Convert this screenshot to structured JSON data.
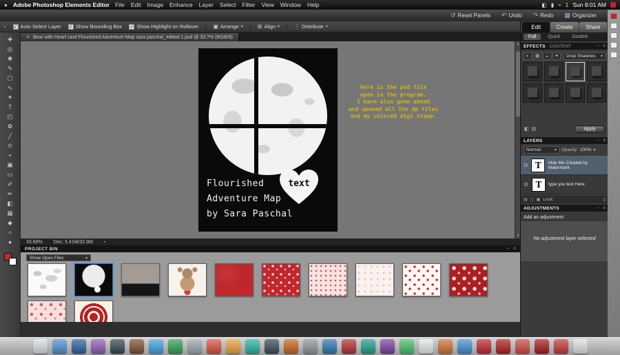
{
  "icons": {
    "apple": "●",
    "display": "◧",
    "battery": "▮",
    "wifi": "≈",
    "reset_panels": "↺",
    "undo": "↶",
    "redo": "↷",
    "organizer": "▦",
    "arrange": "▣",
    "align": "⊞",
    "distribute": "⋮",
    "dropdown_arrow": "▾",
    "close": "✕",
    "check": "✓",
    "collapse": "−",
    "panel_menu": "≡",
    "eye": "⊙",
    "text_layer_thumb": "T",
    "scroll_up": "▲",
    "scroll_down": "▼",
    "status_arrow": "▸",
    "trash": "▯"
  },
  "menubar": {
    "app_name": "Adobe Photoshop Elements Editor",
    "menus": [
      "File",
      "Edit",
      "Image",
      "Enhance",
      "Layer",
      "Select",
      "Filter",
      "View",
      "Window",
      "Help"
    ],
    "notification_count": "1",
    "clock": "Sun 8:01 AM"
  },
  "toolbar": {
    "reset_panels": "Reset Panels",
    "undo": "Undo",
    "redo": "Redo",
    "organizer": "Organizer"
  },
  "options_bar": {
    "checkboxes": [
      "Auto Select Layer",
      "Show Bounding Box",
      "Show Highlight on Rollover"
    ],
    "arrange": "Arrange",
    "align": "Align",
    "distribute": "Distribute"
  },
  "document": {
    "tab_title": "Bear with Heart card Flourished Adventure Map sara paschal_edited-1.psd @ 33.7% (RGB/8)",
    "card": {
      "title_lines": [
        "Flourished",
        "Adventure Map",
        "by Sara Paschal"
      ],
      "heart_text": "text"
    },
    "annotation_lines": [
      "here is the psd file",
      "open in the program.",
      "I have also gone ahead",
      "and opened all the dp files",
      "and my colored digi stamp."
    ],
    "annotation_color": "#d6b411"
  },
  "status_bar": {
    "zoom": "33.69%",
    "doc_size": "Doc: 5.41M/32.8M"
  },
  "tools": [
    {
      "name": "move-tool",
      "glyph": "✚"
    },
    {
      "name": "zoom-tool",
      "glyph": "◎"
    },
    {
      "name": "hand-tool",
      "glyph": "✱"
    },
    {
      "name": "eyedropper-tool",
      "glyph": "✎"
    },
    {
      "name": "rectangular-marquee-tool",
      "glyph": "▢"
    },
    {
      "name": "lasso-tool",
      "glyph": "∿"
    },
    {
      "name": "magic-wand-tool",
      "glyph": "✦"
    },
    {
      "name": "type-tool",
      "glyph": "T"
    },
    {
      "name": "crop-tool",
      "glyph": "◰"
    },
    {
      "name": "cookie-cutter-tool",
      "glyph": "✿"
    },
    {
      "name": "straighten-tool",
      "glyph": "╱"
    },
    {
      "name": "red-eye-removal-tool",
      "glyph": "⊙"
    },
    {
      "name": "healing-brush-tool",
      "glyph": "⌖"
    },
    {
      "name": "clone-stamp-tool",
      "glyph": "▣"
    },
    {
      "name": "eraser-tool",
      "glyph": "▭"
    },
    {
      "name": "brush-tool",
      "glyph": "✐"
    },
    {
      "name": "smart-brush-tool",
      "glyph": "✏"
    },
    {
      "name": "paint-bucket-tool",
      "glyph": "◧"
    },
    {
      "name": "gradient-tool",
      "glyph": "▦"
    },
    {
      "name": "shape-tool",
      "glyph": "◆"
    },
    {
      "name": "blur-tool",
      "glyph": "≈"
    },
    {
      "name": "sponge-tool",
      "glyph": "●"
    }
  ],
  "swatches": {
    "foreground": "#c1272d",
    "background": "#ffffff"
  },
  "project_bin": {
    "title": "PROJECT BIN",
    "dropdown": "Show Open Files",
    "row1": [
      {
        "kind": "world-map"
      },
      {
        "kind": "black-card",
        "selected": true
      },
      {
        "kind": "gray-card"
      },
      {
        "kind": "bear-stamp"
      },
      {
        "kind": "red-solid"
      },
      {
        "kind": "red-floral"
      },
      {
        "kind": "pink-dots"
      },
      {
        "kind": "light-pink-floral"
      },
      {
        "kind": "red-hearts"
      },
      {
        "kind": "red-damask"
      }
    ],
    "row2": [
      {
        "kind": "pink-floral"
      },
      {
        "kind": "red-medallion"
      }
    ]
  },
  "panels": {
    "tabs": [
      {
        "label": "Edit",
        "active": true
      },
      {
        "label": "Create",
        "active": false
      },
      {
        "label": "Share",
        "active": false
      }
    ],
    "subtabs": [
      {
        "label": "Full",
        "active": true
      },
      {
        "label": "Quick",
        "active": false
      },
      {
        "label": "Guided",
        "active": false
      }
    ],
    "effects": {
      "title": "EFFECTS",
      "content_title": "CONTENT",
      "category_icons": [
        {
          "name": "drop-shadow-category-icon",
          "glyph": "◐"
        },
        {
          "name": "bevel-category-icon",
          "glyph": "▦"
        },
        {
          "name": "glow-category-icon",
          "glyph": "◒"
        },
        {
          "name": "star-category-icon",
          "glyph": "✦"
        }
      ],
      "dropdown": "Drop Shadows",
      "thumb_count": 8,
      "selected_index": 2,
      "footer_icons": [
        {
          "name": "favorites-icon",
          "glyph": "◧"
        },
        {
          "name": "thumbnail-view-icon",
          "glyph": "▤"
        }
      ],
      "apply": "Apply"
    },
    "layers": {
      "title": "LAYERS",
      "blend_mode": "Normal",
      "opacity_label": "Opacity:",
      "opacity_value": "100%",
      "rows": [
        {
          "name": "Hide Me Created by Watermark",
          "selected": true
        },
        {
          "name": "type you text Here",
          "selected": false
        }
      ],
      "lock_icons": [
        {
          "name": "link-layers-icon",
          "glyph": "▤"
        },
        {
          "name": "lock-transparency-icon",
          "glyph": "◻"
        },
        {
          "name": "lock-all-icon",
          "glyph": "▣"
        }
      ],
      "lock_label": "Lock:"
    },
    "adjustments": {
      "title": "ADJUSTMENTS",
      "add_label": "Add an adjustment",
      "empty_message": "No adjustment layer selected"
    }
  },
  "dock": {
    "icon_colors": [
      "#d8dde2",
      "#4f8fd0",
      "#2e5f9e",
      "#8f5bb5",
      "#37474f",
      "#7a4f32",
      "#3fa0e0",
      "#2f9e55",
      "#9aa4ac",
      "#d94f3f",
      "#e8a03a",
      "#27b3a0",
      "#3a4a58",
      "#c7651f",
      "#8c949a",
      "#2f76b0",
      "#b03030",
      "#1f9e8a",
      "#7a3fa0",
      "#45c06a",
      "#e4e7ea",
      "#d07030",
      "#3f8fd0",
      "#c1272d",
      "#b01c1c",
      "#d0473f",
      "#a81a1a",
      "#c43838",
      "#e0e0e0"
    ]
  }
}
